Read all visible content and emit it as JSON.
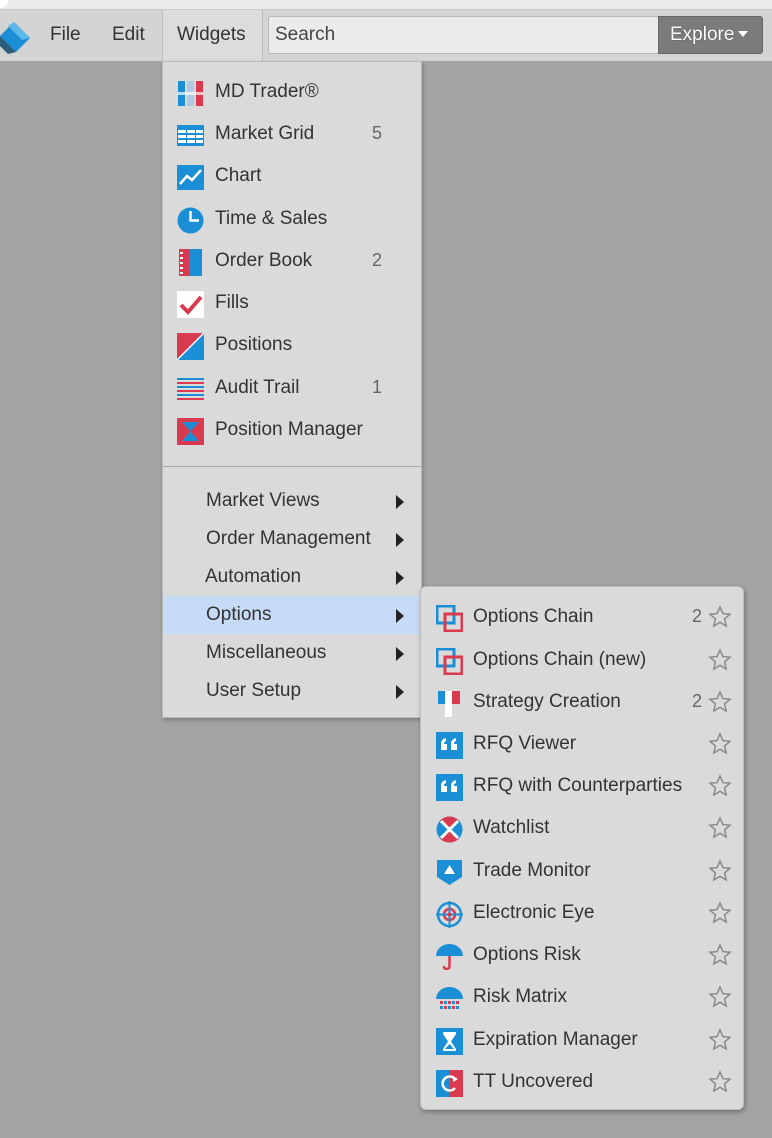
{
  "menubar": {
    "file_label": "File",
    "edit_label": "Edit",
    "widgets_label": "Widgets",
    "search_placeholder": "Search",
    "explore_label": "Explore"
  },
  "widgets_menu": {
    "items": [
      {
        "label": "MD Trader®",
        "count": "",
        "icon": "md-trader-icon"
      },
      {
        "label": "Market Grid",
        "count": "5",
        "icon": "market-grid-icon"
      },
      {
        "label": "Chart",
        "count": "",
        "icon": "chart-icon"
      },
      {
        "label": "Time & Sales",
        "count": "",
        "icon": "time-sales-icon"
      },
      {
        "label": "Order Book",
        "count": "2",
        "icon": "order-book-icon"
      },
      {
        "label": "Fills",
        "count": "",
        "icon": "fills-check-icon"
      },
      {
        "label": "Positions",
        "count": "",
        "icon": "positions-icon"
      },
      {
        "label": "Audit Trail",
        "count": "1",
        "icon": "audit-trail-icon"
      },
      {
        "label": "Position Manager",
        "count": "",
        "icon": "position-manager-icon"
      }
    ],
    "submenus": [
      {
        "label": "Market Views"
      },
      {
        "label": "Order Management"
      },
      {
        "label": "Automation"
      },
      {
        "label": "Options"
      },
      {
        "label": "Miscellaneous"
      },
      {
        "label": "User Setup"
      }
    ]
  },
  "options_menu": {
    "items": [
      {
        "label": "Options Chain",
        "count": "2",
        "icon": "options-chain-icon"
      },
      {
        "label": "Options Chain (new)",
        "count": "",
        "icon": "options-chain-new-icon"
      },
      {
        "label": "Strategy Creation",
        "count": "2",
        "icon": "strategy-creation-icon"
      },
      {
        "label": "RFQ Viewer",
        "count": "",
        "icon": "rfq-viewer-icon"
      },
      {
        "label": "RFQ with Counterparties",
        "count": "",
        "icon": "rfq-counterparties-icon"
      },
      {
        "label": "Watchlist",
        "count": "",
        "icon": "watchlist-icon"
      },
      {
        "label": "Trade Monitor",
        "count": "",
        "icon": "trade-monitor-icon"
      },
      {
        "label": "Electronic Eye",
        "count": "",
        "icon": "electronic-eye-icon"
      },
      {
        "label": "Options Risk",
        "count": "",
        "icon": "options-risk-umbrella-icon"
      },
      {
        "label": "Risk Matrix",
        "count": "",
        "icon": "risk-matrix-icon"
      },
      {
        "label": "Expiration Manager",
        "count": "",
        "icon": "expiration-manager-icon"
      },
      {
        "label": "TT Uncovered",
        "count": "",
        "icon": "tt-uncovered-icon"
      }
    ]
  },
  "colors": {
    "blue": "#1a8fd6",
    "red": "#d93a4f",
    "highlight": "#c6dbf6"
  }
}
